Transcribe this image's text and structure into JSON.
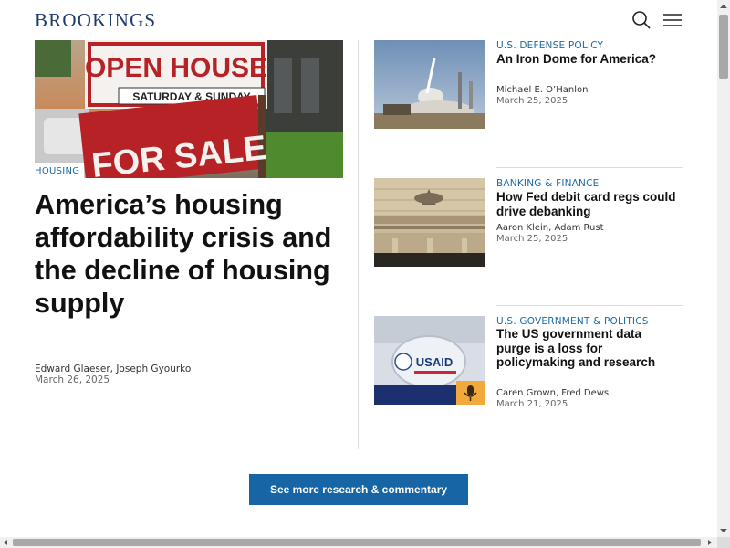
{
  "header": {
    "logo": "BROOKINGS",
    "search_icon": "search-icon",
    "menu_icon": "hamburger-menu-icon"
  },
  "featured": {
    "image_sign_1": "OPEN HOUSE",
    "image_sign_2": "SATURDAY & SUNDAY",
    "image_sign_3": "FOR SALE",
    "tag": "HOUSING",
    "title": "America’s housing affordability crisis and the decline of housing supply",
    "authors": "Edward Glaeser, Joseph Gyourko",
    "date": "March 26, 2025"
  },
  "articles": [
    {
      "tag": "U.S. DEFENSE POLICY",
      "title": "An Iron Dome for America?",
      "authors": "Michael E. O’Hanlon",
      "date": "March 25, 2025"
    },
    {
      "tag": "BANKING & FINANCE",
      "title": "How Fed debit card regs could drive debanking",
      "authors": "Aaron Klein, Adam Rust",
      "date": "March 25, 2025"
    },
    {
      "tag": "U.S. GOVERNMENT & POLITICS",
      "title": "The US government data purge is a loss for policymaking and research",
      "authors": "Caren Grown, Fred Dews",
      "date": "March 21, 2025",
      "image_text": "USAID",
      "badge_icon": "microphone-podcast-icon"
    }
  ],
  "cta": {
    "label": "See more research & commentary"
  },
  "colors": {
    "brand": "#1f3a6e",
    "tag": "#1a6aa6",
    "cta": "#1865a6"
  }
}
